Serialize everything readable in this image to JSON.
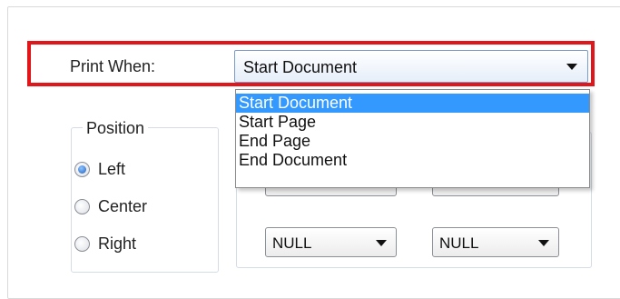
{
  "print_when": {
    "label": "Print When:",
    "value": "Start Document",
    "options": [
      "Start Document",
      "Start Page",
      "End Page",
      "End Document"
    ],
    "selected_index": 0,
    "highlight_color": "#e0161b",
    "selection_color": "#3399ff"
  },
  "position": {
    "title": "Position",
    "options": [
      {
        "label": "Left",
        "checked": true
      },
      {
        "label": "Center",
        "checked": false
      },
      {
        "label": "Right",
        "checked": false
      }
    ]
  },
  "right_group": {
    "combo_left_value": "NULL",
    "combo_right_value": "NULL"
  }
}
